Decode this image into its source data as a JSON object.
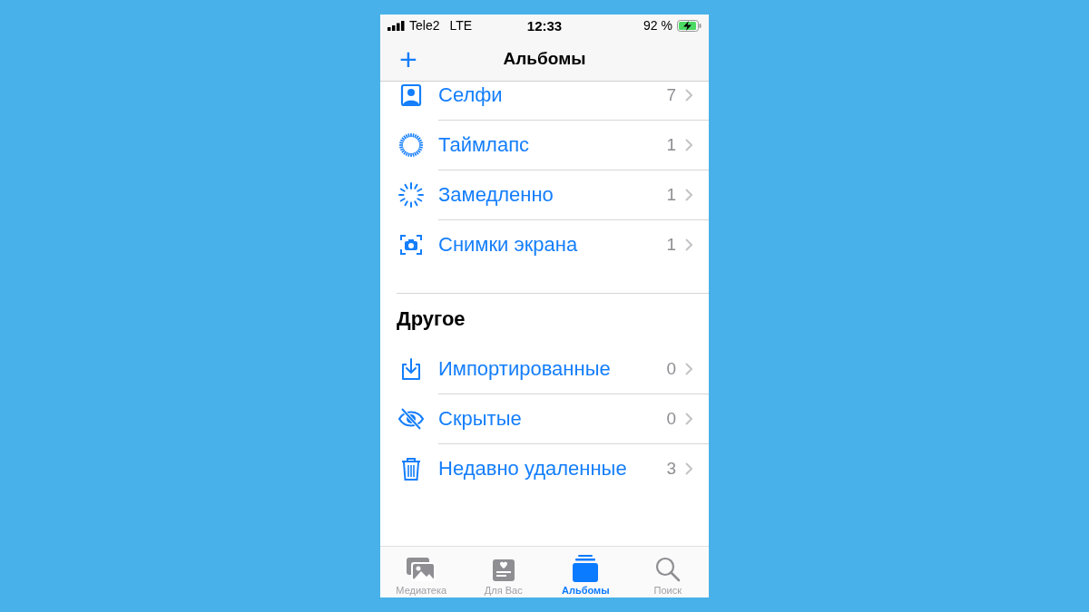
{
  "status_bar": {
    "carrier": "Tele2",
    "network": "LTE",
    "time": "12:33",
    "battery": "92 %"
  },
  "nav_bar": {
    "add_button": "+",
    "title": "Альбомы"
  },
  "sections": [
    {
      "albums": [
        {
          "kind": "selfie",
          "name": "Селфи",
          "count": "7"
        },
        {
          "kind": "timelapse",
          "name": "Таймлапс",
          "count": "1"
        },
        {
          "kind": "slomo",
          "name": "Замедленно",
          "count": "1"
        },
        {
          "kind": "screenshot",
          "name": "Снимки экрана",
          "count": "1"
        }
      ]
    },
    {
      "title": "Другое",
      "albums": [
        {
          "kind": "import",
          "name": "Импортированные",
          "count": "0"
        },
        {
          "kind": "hidden",
          "name": "Скрытые",
          "count": "0"
        },
        {
          "kind": "deleted",
          "name": "Недавно удаленные",
          "count": "3"
        }
      ]
    }
  ],
  "tab_bar": [
    {
      "kind": "library",
      "label": "Медиатека",
      "selected": false
    },
    {
      "kind": "foryou",
      "label": "Для Вас",
      "selected": false
    },
    {
      "kind": "albums",
      "label": "Альбомы",
      "selected": true
    },
    {
      "kind": "search",
      "label": "Поиск",
      "selected": false
    }
  ]
}
